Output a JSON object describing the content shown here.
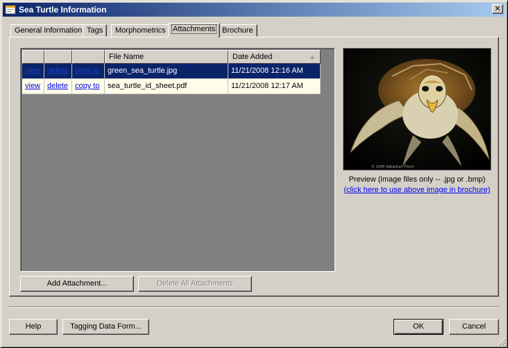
{
  "window": {
    "title": "Sea Turtle Information",
    "close_glyph": "✕"
  },
  "tabs": [
    {
      "label": "General Information",
      "active": false
    },
    {
      "label": "Tags",
      "active": false
    },
    {
      "label": "Morphometrics",
      "active": false
    },
    {
      "label": "Attachments",
      "active": true
    },
    {
      "label": "Brochure",
      "active": false
    }
  ],
  "attachments": {
    "columns": [
      "",
      "",
      "",
      "File Name",
      "Date Added"
    ],
    "sort_indicator": "▲",
    "rows": [
      {
        "view": "view",
        "delete": "delete",
        "copy": "copy to",
        "file_name": "green_sea_turtle.jpg",
        "date_added": "11/21/2008 12:16 AM",
        "selected": true
      },
      {
        "view": "view",
        "delete": "delete",
        "copy": "copy to",
        "file_name": "sea_turtle_id_sheet.pdf",
        "date_added": "11/21/2008 12:17 AM",
        "selected": false
      }
    ],
    "add_button": "Add Attachment...",
    "delete_all_button": "Delete All Attachments"
  },
  "preview": {
    "caption": "Preview (image files only -- .jpg or .bmp)",
    "use_link": "(click here to use above image in brochure)",
    "copyright": "© 2006 Sebastian Frisch"
  },
  "footer": {
    "help_button": "Help",
    "tagging_button": "Tagging Data Form...",
    "ok_button": "OK",
    "cancel_button": "Cancel"
  },
  "icons": [
    "app-icon",
    "close-icon",
    "sort-ascending-icon",
    "resize-grip-icon"
  ]
}
